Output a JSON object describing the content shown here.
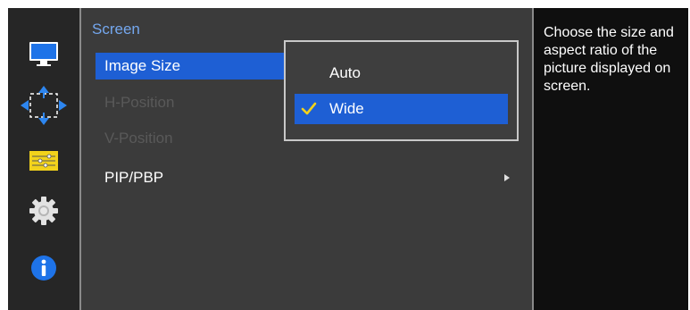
{
  "menu": {
    "title": "Screen",
    "items": [
      {
        "label": "Image Size",
        "state": "selected"
      },
      {
        "label": "H-Position",
        "state": "disabled"
      },
      {
        "label": "V-Position",
        "state": "disabled"
      },
      {
        "label": "PIP/PBP",
        "state": "normal",
        "has_submenu": true
      }
    ]
  },
  "submenu": {
    "options": [
      {
        "label": "Auto",
        "checked": false
      },
      {
        "label": "Wide",
        "checked": true
      }
    ]
  },
  "description": {
    "text": "Choose the size and aspect ratio of the picture displayed on screen."
  },
  "rail": {
    "icons": [
      "monitor-icon",
      "screen-position-icon",
      "color-settings-icon",
      "gear-icon",
      "info-icon"
    ]
  },
  "colors": {
    "accent_blue": "#1e5fd4",
    "title_blue": "#74a7ee",
    "check_yellow": "#f2d21b",
    "disabled_text": "#595959"
  }
}
